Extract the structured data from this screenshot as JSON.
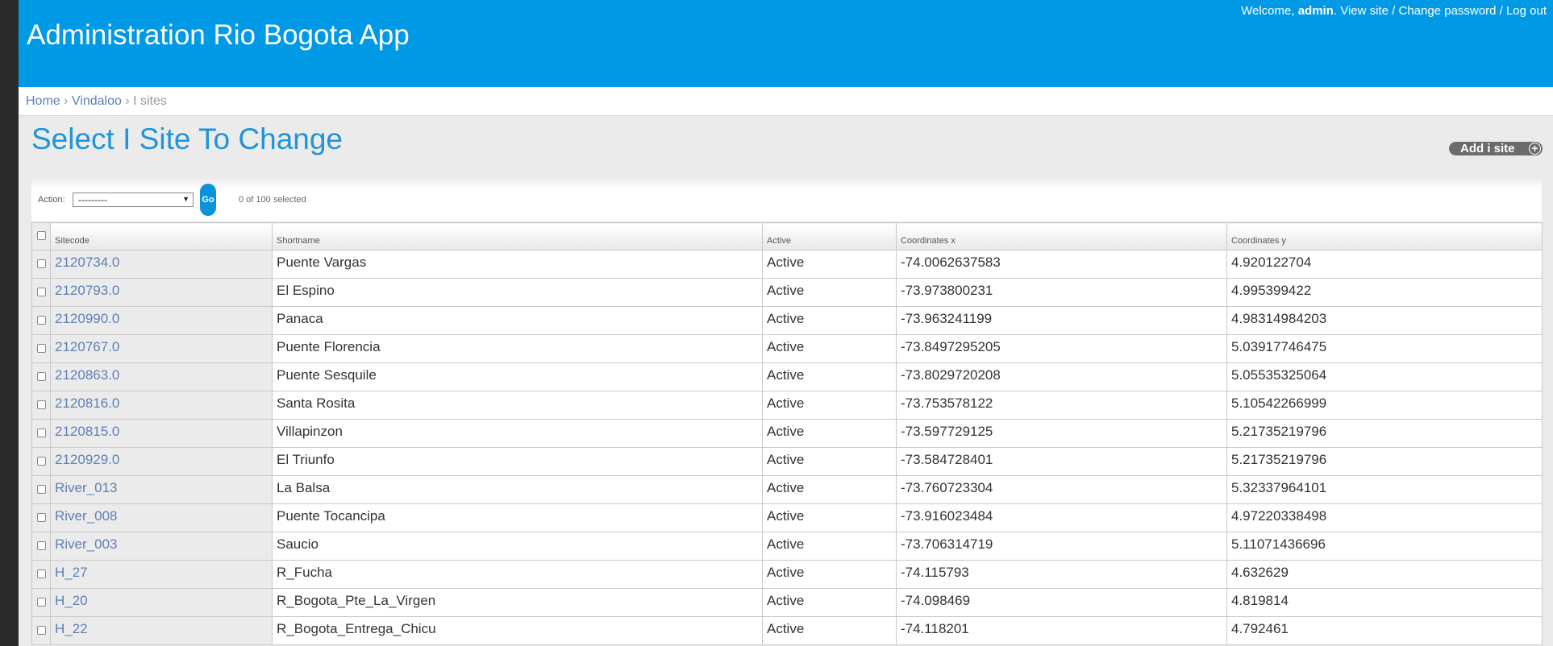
{
  "header": {
    "site_title": "Administration Rio Bogota App",
    "welcome": "Welcome, ",
    "username": "admin",
    "view_site": "View site",
    "change_password": "Change password",
    "logout": "Log out",
    "separator": " / "
  },
  "breadcrumbs": {
    "home": "Home",
    "app": "Vindaloo",
    "current": "I sites",
    "sep": " › "
  },
  "content": {
    "title": "Select I Site To Change",
    "add_button": "Add i site",
    "add_icon": "plus-icon"
  },
  "actions": {
    "label": "Action:",
    "selected_option": "---------",
    "go_label": "Go",
    "selected_count": "0 of 100 selected"
  },
  "table": {
    "headers": [
      "Sitecode",
      "Shortname",
      "Active",
      "Coordinates x",
      "Coordinates y"
    ],
    "rows": [
      {
        "sitecode": "2120734.0",
        "shortname": "Puente Vargas",
        "active": "Active",
        "x": "-74.0062637583",
        "y": "4.920122704"
      },
      {
        "sitecode": "2120793.0",
        "shortname": "El Espino",
        "active": "Active",
        "x": "-73.973800231",
        "y": "4.995399422"
      },
      {
        "sitecode": "2120990.0",
        "shortname": "Panaca",
        "active": "Active",
        "x": "-73.963241199",
        "y": "4.98314984203"
      },
      {
        "sitecode": "2120767.0",
        "shortname": "Puente Florencia",
        "active": "Active",
        "x": "-73.8497295205",
        "y": "5.03917746475"
      },
      {
        "sitecode": "2120863.0",
        "shortname": "Puente Sesquile",
        "active": "Active",
        "x": "-73.8029720208",
        "y": "5.05535325064"
      },
      {
        "sitecode": "2120816.0",
        "shortname": "Santa Rosita",
        "active": "Active",
        "x": "-73.753578122",
        "y": "5.10542266999"
      },
      {
        "sitecode": "2120815.0",
        "shortname": "Villapinzon",
        "active": "Active",
        "x": "-73.597729125",
        "y": "5.21735219796"
      },
      {
        "sitecode": "2120929.0",
        "shortname": "El Triunfo",
        "active": "Active",
        "x": "-73.584728401",
        "y": "5.21735219796"
      },
      {
        "sitecode": "River_013",
        "shortname": "La Balsa",
        "active": "Active",
        "x": "-73.760723304",
        "y": "5.32337964101"
      },
      {
        "sitecode": "River_008",
        "shortname": "Puente Tocancipa",
        "active": "Active",
        "x": "-73.916023484",
        "y": "4.97220338498"
      },
      {
        "sitecode": "River_003",
        "shortname": "Saucio",
        "active": "Active",
        "x": "-73.706314719",
        "y": "5.11071436696"
      },
      {
        "sitecode": "H_27",
        "shortname": "R_Fucha",
        "active": "Active",
        "x": "-74.115793",
        "y": "4.632629"
      },
      {
        "sitecode": "H_20",
        "shortname": "R_Bogota_Pte_La_Virgen",
        "active": "Active",
        "x": "-74.098469",
        "y": "4.819814"
      },
      {
        "sitecode": "H_22",
        "shortname": "R_Bogota_Entrega_Chicu",
        "active": "Active",
        "x": "-74.118201",
        "y": "4.792461"
      }
    ]
  }
}
